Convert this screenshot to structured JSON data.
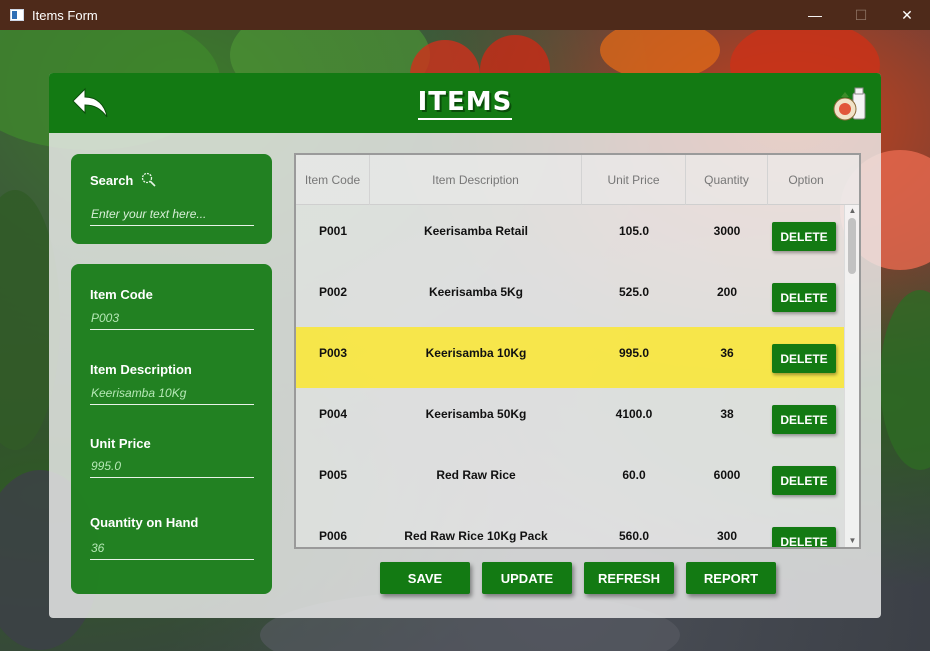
{
  "window": {
    "title": "Items Form",
    "controls": {
      "minimize": "—",
      "maximize": "☐",
      "close": "✕"
    }
  },
  "header": {
    "title": "ITEMS",
    "back_icon": "back-arrow-icon",
    "right_icon": "grocery-icon"
  },
  "search": {
    "label": "Search",
    "placeholder": "Enter your text here...",
    "icon": "search-icon"
  },
  "form": {
    "item_code": {
      "label": "Item Code",
      "value": "P003"
    },
    "item_description": {
      "label": "Item Description",
      "value": "Keerisamba 10Kg"
    },
    "unit_price": {
      "label": "Unit Price",
      "value": "995.0"
    },
    "quantity_on_hand": {
      "label": "Quantity on Hand",
      "value": "36"
    }
  },
  "table": {
    "columns": [
      "Item Code",
      "Item Description",
      "Unit Price",
      "Quantity",
      "Option"
    ],
    "rows": [
      {
        "code": "P001",
        "description": "Keerisamba Retail",
        "unit_price": "105.0",
        "quantity": "3000",
        "action": "DELETE"
      },
      {
        "code": "P002",
        "description": "Keerisamba 5Kg",
        "unit_price": "525.0",
        "quantity": "200",
        "action": "DELETE"
      },
      {
        "code": "P003",
        "description": "Keerisamba 10Kg",
        "unit_price": "995.0",
        "quantity": "36",
        "action": "DELETE"
      },
      {
        "code": "P004",
        "description": "Keerisamba 50Kg",
        "unit_price": "4100.0",
        "quantity": "38",
        "action": "DELETE"
      },
      {
        "code": "P005",
        "description": "Red Raw Rice",
        "unit_price": "60.0",
        "quantity": "6000",
        "action": "DELETE"
      },
      {
        "code": "P006",
        "description": "Red Raw Rice 10Kg Pack",
        "unit_price": "560.0",
        "quantity": "300",
        "action": "DELETE"
      }
    ],
    "selected_row": 2
  },
  "actions": {
    "save": "SAVE",
    "update": "UPDATE",
    "refresh": "REFRESH",
    "report": "REPORT"
  },
  "colors": {
    "primary_green": "#137a13",
    "selection_yellow": "#ffe81a",
    "titlebar": "#4e2a1a"
  }
}
